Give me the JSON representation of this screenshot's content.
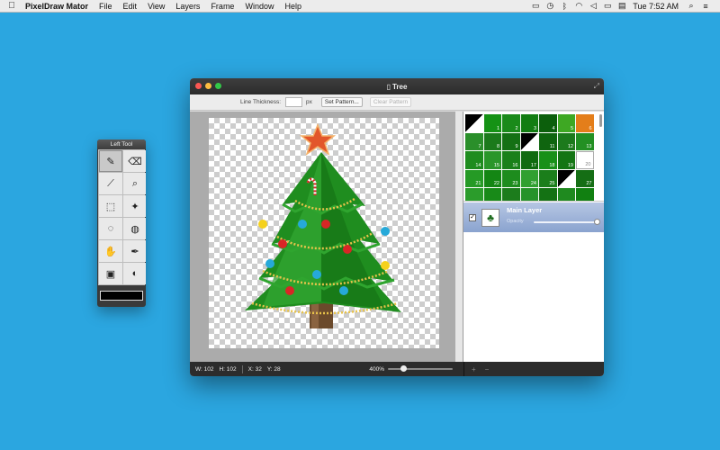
{
  "menubar": {
    "apple_icon": "apple-logo",
    "app_name": "PixelDraw Mator",
    "menus": [
      "File",
      "Edit",
      "View",
      "Layers",
      "Frame",
      "Window",
      "Help"
    ],
    "status_icons": [
      "battery-menu-icon",
      "time-machine-icon",
      "bluetooth-icon",
      "wifi-icon",
      "volume-icon",
      "battery-icon",
      "us-flag-icon"
    ],
    "clock": "Tue 7:52 AM",
    "right_icons": [
      "spotlight-icon",
      "notification-center-icon"
    ]
  },
  "tool_palette": {
    "title": "Left Tool",
    "tools": [
      {
        "name": "pencil-tool",
        "glyph": "✎",
        "active": true
      },
      {
        "name": "eraser-tool",
        "glyph": "⌫",
        "active": false
      },
      {
        "name": "line-tool",
        "glyph": "⟋",
        "active": false
      },
      {
        "name": "zoom-tool",
        "glyph": "⌕",
        "active": false
      },
      {
        "name": "rect-select-tool",
        "glyph": "⬚",
        "active": false
      },
      {
        "name": "magic-wand-tool",
        "glyph": "✦",
        "active": false
      },
      {
        "name": "lasso-tool",
        "glyph": "◌",
        "active": false
      },
      {
        "name": "paint-bucket-tool",
        "glyph": "◍",
        "active": false
      },
      {
        "name": "hand-tool",
        "glyph": "✋",
        "active": false
      },
      {
        "name": "eyedropper-tool",
        "glyph": "✒",
        "active": false
      },
      {
        "name": "stamp-tool",
        "glyph": "▣",
        "active": false
      },
      {
        "name": "gradient-tool",
        "glyph": "◐",
        "active": false
      }
    ],
    "current_color": "#000000"
  },
  "document": {
    "title": "Tree",
    "toolbar": {
      "line_thickness_label": "Line Thickness:",
      "line_thickness_value": "",
      "unit": "px",
      "set_pattern": "Set Pattern...",
      "clear_pattern": "Clear Pattern"
    },
    "patterns": [
      {
        "n": "",
        "kind": "diag",
        "color": "#1c8f1c"
      },
      {
        "n": "1",
        "kind": "solid",
        "color": "#159215"
      },
      {
        "n": "2",
        "kind": "solid",
        "color": "#1a8a1a"
      },
      {
        "n": "3",
        "kind": "solid",
        "color": "#127d12"
      },
      {
        "n": "4",
        "kind": "solid",
        "color": "#0c5f0c"
      },
      {
        "n": "5",
        "kind": "solid",
        "color": "#3ea823"
      },
      {
        "n": "6",
        "kind": "solid",
        "color": "#e47e1a"
      },
      {
        "n": "7",
        "kind": "solid",
        "color": "#2a8f2a"
      },
      {
        "n": "8",
        "kind": "solid",
        "color": "#1b7a1b"
      },
      {
        "n": "9",
        "kind": "solid",
        "color": "#147014"
      },
      {
        "n": "10",
        "kind": "diag",
        "color": "#1a7a1a"
      },
      {
        "n": "11",
        "kind": "solid",
        "color": "#0f650f"
      },
      {
        "n": "12",
        "kind": "solid",
        "color": "#1c7a1c"
      },
      {
        "n": "13",
        "kind": "solid",
        "color": "#239023"
      },
      {
        "n": "14",
        "kind": "solid",
        "color": "#1e8c1e"
      },
      {
        "n": "15",
        "kind": "solid",
        "color": "#2a962a"
      },
      {
        "n": "16",
        "kind": "solid",
        "color": "#1a801a"
      },
      {
        "n": "17",
        "kind": "solid",
        "color": "#106b10"
      },
      {
        "n": "18",
        "kind": "solid",
        "color": "#189018"
      },
      {
        "n": "19",
        "kind": "solid",
        "color": "#147514"
      },
      {
        "n": "20",
        "kind": "white",
        "color": "#ffffff"
      },
      {
        "n": "21",
        "kind": "solid",
        "color": "#259a25"
      },
      {
        "n": "22",
        "kind": "solid",
        "color": "#148614"
      },
      {
        "n": "23",
        "kind": "solid",
        "color": "#1d8c1d"
      },
      {
        "n": "24",
        "kind": "solid",
        "color": "#30a030"
      },
      {
        "n": "25",
        "kind": "solid",
        "color": "#1b7e1b"
      },
      {
        "n": "26",
        "kind": "diag",
        "color": "#178417"
      },
      {
        "n": "27",
        "kind": "solid",
        "color": "#156e15"
      },
      {
        "n": "",
        "kind": "solid",
        "color": "#2b9c2b"
      },
      {
        "n": "",
        "kind": "solid",
        "color": "#188a18"
      },
      {
        "n": "",
        "kind": "solid",
        "color": "#1c7c1c"
      },
      {
        "n": "",
        "kind": "solid",
        "color": "#26932a"
      },
      {
        "n": "",
        "kind": "solid",
        "color": "#147214"
      },
      {
        "n": "",
        "kind": "solid",
        "color": "#1f8a1f"
      },
      {
        "n": "",
        "kind": "solid",
        "color": "#118011"
      }
    ],
    "layer": {
      "checked": "✓",
      "name": "Main Layer",
      "opacity_label": "Opacity",
      "opacity": 1.0,
      "thumb_icon": "tree-icon"
    },
    "status": {
      "width": "W: 102",
      "height": "H: 102",
      "x": "X: 32",
      "y": "Y: 28",
      "zoom": "400%",
      "zoom_level": 0.2,
      "add_layer": "+",
      "remove_layer": "−"
    }
  }
}
